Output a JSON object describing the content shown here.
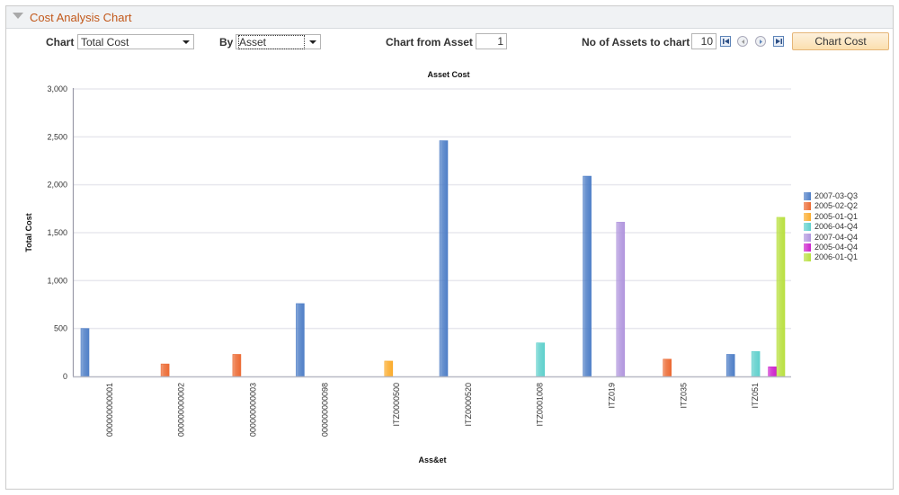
{
  "panel": {
    "title": "Cost Analysis Chart",
    "collapse_icon": "triangle-down-icon"
  },
  "controls": {
    "chart_label": "Chart",
    "chart_value": "Total Cost",
    "by_label": "By",
    "by_value": "Asset",
    "chart_from_label": "Chart from Asset",
    "chart_from_value": "1",
    "no_assets_label": "No of Assets to chart",
    "no_assets_value": "10",
    "nav_icons": [
      "first-page-icon",
      "previous-icon",
      "next-icon",
      "last-page-icon"
    ],
    "chart_cost_button": "Chart Cost"
  },
  "chart_data": {
    "type": "bar",
    "title": "Asset Cost",
    "xlabel": "Ass&et",
    "ylabel": "Total Cost",
    "ylim": [
      0,
      3000
    ],
    "yticks": [
      0,
      500,
      1000,
      1500,
      2000,
      2500,
      3000
    ],
    "ytick_labels": [
      "0",
      "500",
      "1,000",
      "1,500",
      "2,000",
      "2,500",
      "3,000"
    ],
    "grid": true,
    "legend_position": "right",
    "categories": [
      "000000000001",
      "000000000002",
      "000000000003",
      "000000000098",
      "ITZ0000500",
      "ITZ0000520",
      "ITZ0001008",
      "ITZ019",
      "ITZ035",
      "ITZ051"
    ],
    "series": [
      {
        "name": "2007-03-Q3",
        "color": "#4f7fc7",
        "values": [
          500,
          null,
          null,
          760,
          null,
          2460,
          null,
          2090,
          null,
          230
        ]
      },
      {
        "name": "2005-02-Q2",
        "color": "#ec6a33",
        "values": [
          null,
          130,
          230,
          null,
          null,
          null,
          null,
          null,
          180,
          null
        ]
      },
      {
        "name": "2005-01-Q1",
        "color": "#fbac2c",
        "values": [
          null,
          null,
          null,
          null,
          160,
          null,
          null,
          null,
          null,
          null
        ]
      },
      {
        "name": "2006-04-Q4",
        "color": "#5fd0cc",
        "values": [
          null,
          null,
          null,
          null,
          null,
          null,
          350,
          null,
          null,
          260
        ]
      },
      {
        "name": "2007-04-Q4",
        "color": "#b196de",
        "values": [
          null,
          null,
          null,
          null,
          null,
          null,
          null,
          1610,
          null,
          null
        ]
      },
      {
        "name": "2005-04-Q4",
        "color": "#cc22cc",
        "values": [
          null,
          null,
          null,
          null,
          null,
          null,
          null,
          null,
          null,
          100
        ]
      },
      {
        "name": "2006-01-Q1",
        "color": "#b9e040",
        "values": [
          null,
          null,
          null,
          null,
          null,
          null,
          null,
          null,
          null,
          1660
        ]
      }
    ]
  }
}
